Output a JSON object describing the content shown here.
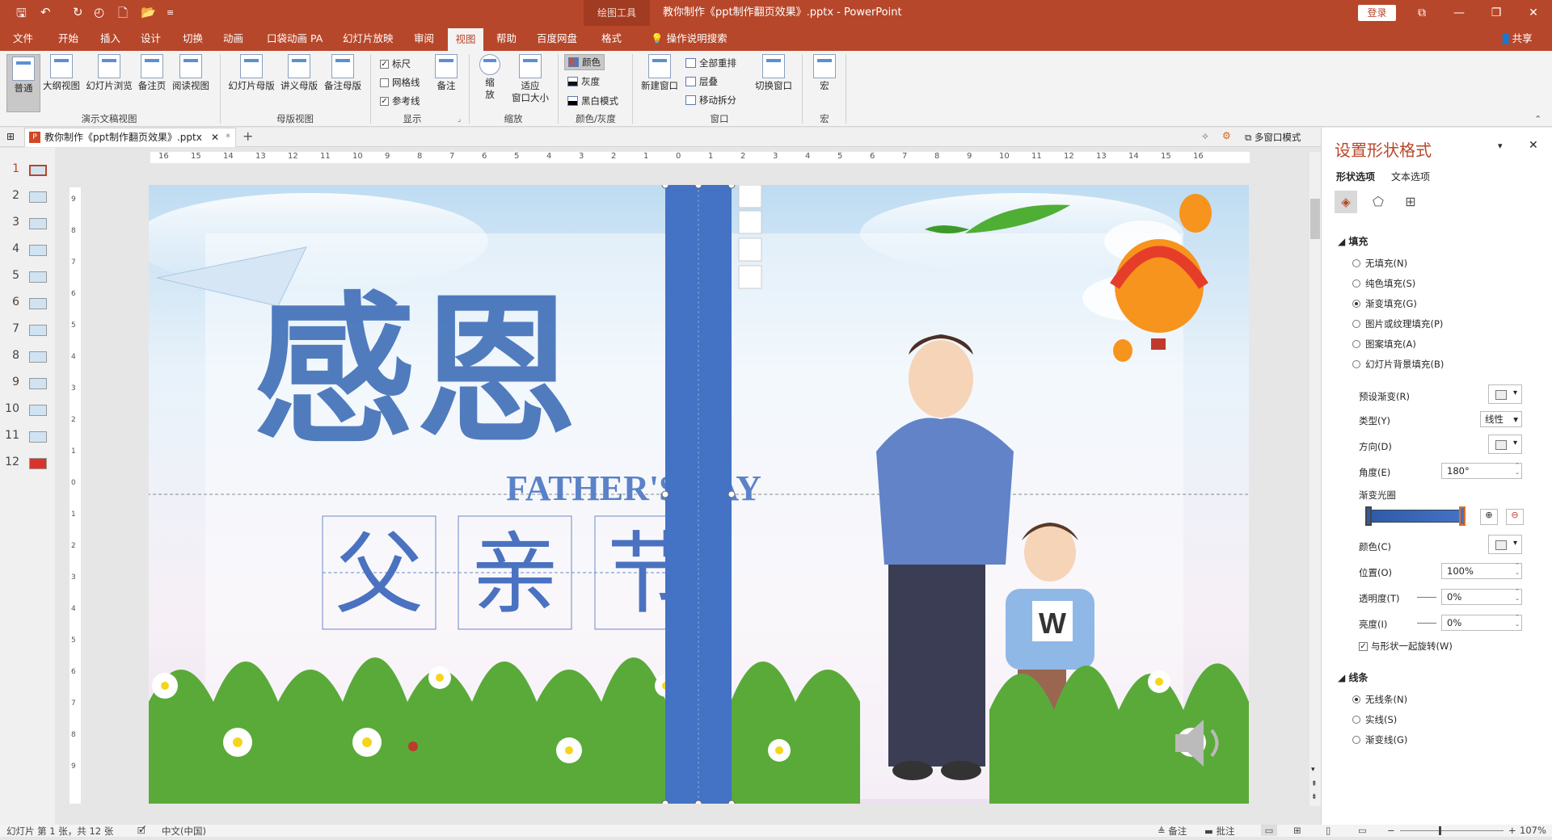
{
  "titlebar": {
    "context_tab": "绘图工具",
    "title": "教你制作《ppt制作翻页效果》.pptx  -  PowerPoint",
    "login": "登录",
    "window_buttons": [
      "⧉",
      "—",
      "❐",
      "✕"
    ]
  },
  "tabs": [
    "文件",
    "开始",
    "插入",
    "设计",
    "切换",
    "动画",
    "口袋动画 PA",
    "幻灯片放映",
    "审阅",
    "视图",
    "帮助",
    "百度网盘",
    "格式"
  ],
  "active_tab": "视图",
  "tell_me": "操作说明搜索",
  "share": "共享",
  "ribbon": {
    "presentation_views": {
      "label": "演示文稿视图",
      "buttons": [
        "普通",
        "大纲视图",
        "幻灯片浏览",
        "备注页",
        "阅读视图"
      ]
    },
    "master_views": {
      "label": "母版视图",
      "buttons": [
        "幻灯片母版",
        "讲义母版",
        "备注母版"
      ]
    },
    "show": {
      "label": "显示",
      "ruler": "标尺",
      "gridlines": "网格线",
      "guides": "参考线",
      "notes": "备注",
      "ruler_checked": true,
      "gridlines_checked": false,
      "guides_checked": true
    },
    "zoom": {
      "label": "缩放",
      "zoom": "缩\n放",
      "fit": "适应\n窗口大小"
    },
    "color": {
      "label": "颜色/灰度",
      "items": [
        "颜色",
        "灰度",
        "黑白模式"
      ]
    },
    "window": {
      "label": "窗口",
      "new_window": "新建窗口",
      "items": [
        "全部重排",
        "层叠",
        "移动拆分"
      ],
      "switch": "切换窗口"
    },
    "macros": {
      "label": "宏",
      "button": "宏"
    }
  },
  "doc_tab": {
    "name": "教你制作《ppt制作翻页效果》.pptx",
    "modified": "*"
  },
  "multi_window": "多窗口模式",
  "slides": [
    "1",
    "2",
    "3",
    "4",
    "5",
    "6",
    "7",
    "8",
    "9",
    "10",
    "11",
    "12"
  ],
  "current_slide": "1",
  "hruler_ticks": [
    "16",
    "15",
    "14",
    "13",
    "12",
    "11",
    "10",
    "9",
    "8",
    "7",
    "6",
    "5",
    "4",
    "3",
    "2",
    "1",
    "0",
    "1",
    "2",
    "3",
    "4",
    "5",
    "6",
    "7",
    "8",
    "9",
    "10",
    "11",
    "12",
    "13",
    "14",
    "15",
    "16"
  ],
  "vruler_ticks": [
    "9",
    "8",
    "7",
    "6",
    "5",
    "4",
    "3",
    "2",
    "1",
    "0",
    "1",
    "2",
    "3",
    "4",
    "5",
    "6",
    "7",
    "8",
    "9"
  ],
  "slide": {
    "title_big": "感恩",
    "subtitle": "FATHER'S DAY",
    "chars": [
      "父",
      "亲",
      "节"
    ],
    "shirt_letter": "W"
  },
  "format_pane": {
    "title": "设置形状格式",
    "tabs": [
      "形状选项",
      "文本选项"
    ],
    "fill_header": "填充",
    "fill_options": [
      "无填充(N)",
      "纯色填充(S)",
      "渐变填充(G)",
      "图片或纹理填充(P)",
      "图案填充(A)",
      "幻灯片背景填充(B)"
    ],
    "fill_selected": 2,
    "preset": "预设渐变(R)",
    "type_label": "类型(Y)",
    "type_value": "线性",
    "direction": "方向(D)",
    "angle_label": "角度(E)",
    "angle_value": "180°",
    "stops_label": "渐变光圈",
    "color_label": "颜色(C)",
    "position_label": "位置(O)",
    "position_value": "100%",
    "transparency_label": "透明度(T)",
    "transparency_value": "0%",
    "brightness_label": "亮度(I)",
    "brightness_value": "0%",
    "rotate_label": "与形状一起旋转(W)",
    "line_header": "线条",
    "line_options": [
      "无线条(N)",
      "实线(S)",
      "渐变线(G)"
    ],
    "line_selected": 0
  },
  "status": {
    "slide_info": "幻灯片 第 1 张，共 12 张",
    "language": "中文(中国)",
    "notes": "备注",
    "comments": "批注",
    "zoom": "107%"
  },
  "colors": {
    "accent": "#b7472a",
    "shape": "#4472c4"
  }
}
